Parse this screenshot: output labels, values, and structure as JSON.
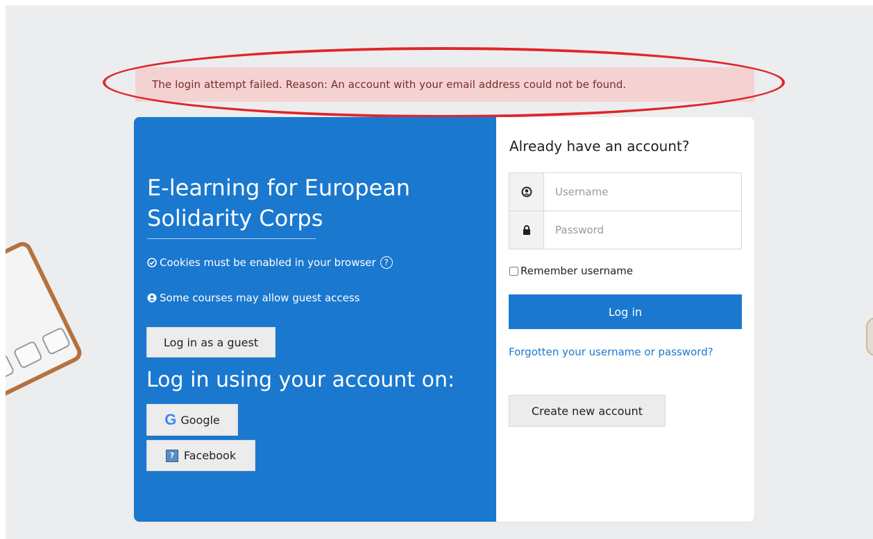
{
  "alert": {
    "message": "The login attempt failed. Reason: An account with your email address could not be found."
  },
  "left_panel": {
    "site_title": "E-learning for European Solidarity Corps",
    "cookies_text": "Cookies must be enabled in your browser",
    "guest_info_text": "Some courses may allow guest access",
    "guest_button_label": "Log in as a guest",
    "oauth_heading": "Log in using your account on:",
    "providers": [
      {
        "label": "Google",
        "icon": "google-icon"
      },
      {
        "label": "Facebook",
        "icon": "facebook-icon"
      }
    ]
  },
  "right_panel": {
    "heading": "Already have an account?",
    "username_placeholder": "Username",
    "password_placeholder": "Password",
    "remember_label": "Remember username",
    "login_button_label": "Log in",
    "forgot_link": "Forgotten your username or password?",
    "create_account_label": "Create new account"
  },
  "colors": {
    "brand": "#1a78cf",
    "alert_bg": "#f4d2d2",
    "alert_highlight": "#e0252b",
    "page_bg": "#ecedee"
  }
}
